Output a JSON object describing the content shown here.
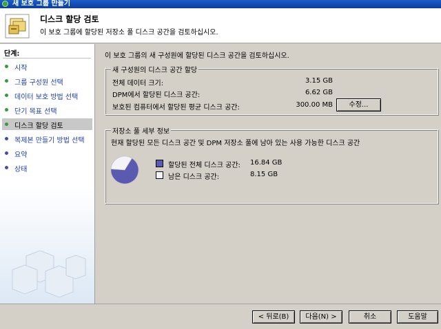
{
  "window": {
    "title": "새 보호 그룹 만들기"
  },
  "header": {
    "title": "디스크 할당 검토",
    "subtitle": "이 보호 그룹에 할당된 저장소 풀 디스크 공간을 검토하십시오."
  },
  "steps": {
    "title": "단계:",
    "items": [
      {
        "label": "시작",
        "status": "done",
        "color": "#3a9a3a"
      },
      {
        "label": "그룹 구성원 선택",
        "status": "done",
        "color": "#3a9a3a"
      },
      {
        "label": "데이터 보호 방법 선택",
        "status": "done",
        "color": "#3a9a3a"
      },
      {
        "label": "단기 목표 선택",
        "status": "done",
        "color": "#3a9a3a"
      },
      {
        "label": "디스크 할당 검토",
        "status": "current",
        "color": "#3a9a3a"
      },
      {
        "label": "복제본 만들기 방법 선택",
        "status": "pending",
        "color": "#4a4aa8"
      },
      {
        "label": "요약",
        "status": "pending",
        "color": "#4a4aa8"
      },
      {
        "label": "상태",
        "status": "pending",
        "color": "#4a4aa8"
      }
    ]
  },
  "main": {
    "intro": "이 보호 그룹의 새 구성원에 할당된 디스크 공간을 검토하십시오.",
    "allocation": {
      "legend": "새 구성원의 디스크 공간 할당",
      "rows": [
        {
          "label": "전체 데이터 크기:",
          "value": "3.15 GB"
        },
        {
          "label": "DPM에서 할당된 디스크 공간:",
          "value": "6.62 GB"
        },
        {
          "label": "보호된 컴퓨터에서 할당된 평균 디스크 공간:",
          "value": "300.00 MB"
        }
      ],
      "modify_button": "수정..."
    },
    "storage": {
      "legend": "저장소 풀 세부 정보",
      "description": "현재 할당된 모든 디스크 공간 및 DPM 저장소 풀에 남아 있는 사용 가능한 디스크 공간",
      "legend_items": [
        {
          "label": "할당된 전체 디스크 공간:",
          "value": "16.84 GB",
          "color": "#5a5ab0"
        },
        {
          "label": "남은 디스크 공간:",
          "value": "8.15 GB",
          "color": "#f4f4f8"
        }
      ]
    }
  },
  "chart_data": {
    "type": "pie",
    "categories": [
      "할당된 전체 디스크 공간",
      "남은 디스크 공간"
    ],
    "values": [
      16.84,
      8.15
    ],
    "units": "GB",
    "colors": [
      "#5a5ab0",
      "#f4f4f8"
    ]
  },
  "buttons": {
    "back": "< 뒤로(B)",
    "next": "다음(N) >",
    "cancel": "취소",
    "help": "도움말"
  }
}
